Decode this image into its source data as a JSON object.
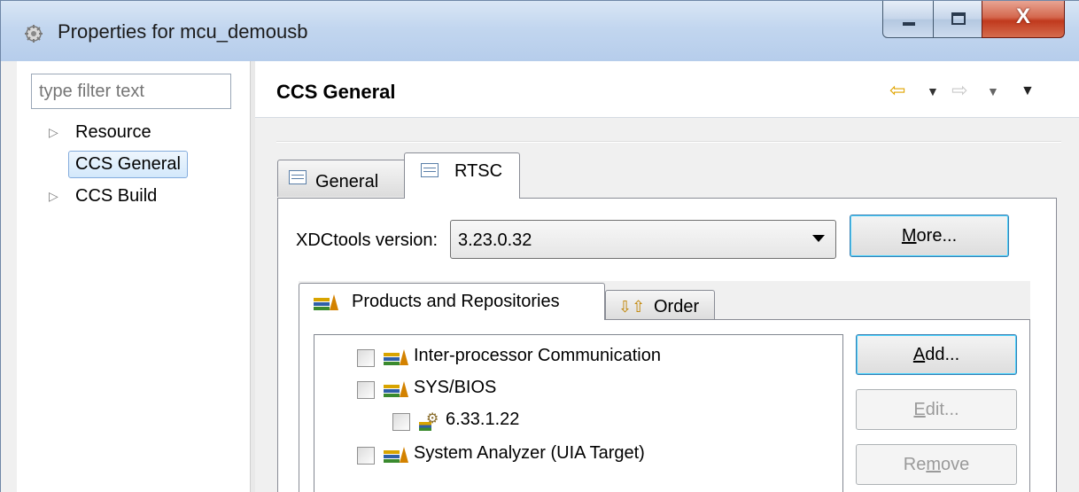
{
  "window": {
    "title": "Properties for mcu_demousb",
    "minimize_icon": "minimize-icon",
    "maximize_icon": "maximize-icon",
    "close_glyph": "X"
  },
  "left_pane": {
    "filter_placeholder": "type filter text",
    "tree": [
      {
        "label": "Resource",
        "expandable": true,
        "selected": false
      },
      {
        "label": "CCS General",
        "expandable": false,
        "selected": true
      },
      {
        "label": "CCS Build",
        "expandable": true,
        "selected": false
      }
    ],
    "expand_glyph": "▷"
  },
  "header": {
    "title": "CCS General",
    "back_glyph": "⇦",
    "forward_glyph": "⇨",
    "dropdown_glyph": "▼"
  },
  "tabs": [
    {
      "label": "General",
      "active": false
    },
    {
      "label": "RTSC",
      "active": true
    }
  ],
  "rtsc": {
    "xdctools_label": "XDCtools version:",
    "xdctools_value": "3.23.0.32",
    "more_button": {
      "pre": "",
      "mnemonic": "M",
      "post": "ore..."
    },
    "inner_tabs": [
      {
        "label": "Products and Repositories",
        "active": true
      },
      {
        "label": "Order",
        "active": false
      }
    ],
    "products": [
      {
        "label": "Inter-processor Communication",
        "checked": false,
        "level": 0,
        "icon": "library-icon"
      },
      {
        "label": "SYS/BIOS",
        "checked": false,
        "level": 0,
        "icon": "library-icon"
      },
      {
        "label": "6.33.1.22",
        "checked": false,
        "level": 1,
        "icon": "package-gear-icon"
      },
      {
        "label": "System Analyzer (UIA Target)",
        "checked": false,
        "level": 0,
        "icon": "library-icon"
      }
    ],
    "add_button": {
      "mnemonic": "A",
      "post": "dd..."
    },
    "edit_button": {
      "mnemonic": "E",
      "post": "dit..."
    },
    "remove_button": {
      "pre": "Re",
      "mnemonic": "m",
      "post": "ove"
    }
  },
  "colors": {
    "selection_border": "#84acdd",
    "default_button_border": "#3c7fb1",
    "close_button": "#c0391d",
    "back_arrow": "#e0a400"
  }
}
